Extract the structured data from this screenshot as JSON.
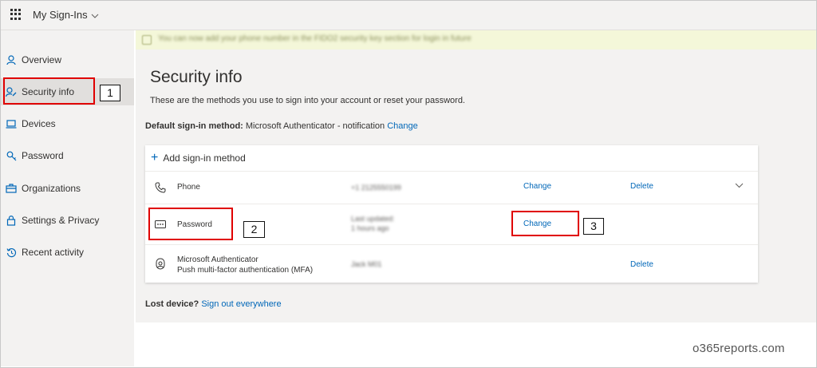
{
  "header": {
    "app_title": "My Sign-Ins",
    "title_chevron": "⌄"
  },
  "sidebar": {
    "items": [
      {
        "label": "Overview",
        "icon": "person-icon"
      },
      {
        "label": "Security info",
        "icon": "security-info-icon",
        "active": true
      },
      {
        "label": "Devices",
        "icon": "laptop-icon"
      },
      {
        "label": "Password",
        "icon": "key-icon"
      },
      {
        "label": "Organizations",
        "icon": "briefcase-icon"
      },
      {
        "label": "Settings & Privacy",
        "icon": "lock-icon"
      },
      {
        "label": "Recent activity",
        "icon": "history-icon"
      }
    ]
  },
  "banner": {
    "text": "You can now add your phone number in the FIDO2 security key section for login in future"
  },
  "main": {
    "title": "Security info",
    "description": "These are the methods you use to sign into your account or reset your password.",
    "default_label": "Default sign-in method:",
    "default_value": "Microsoft Authenticator - notification",
    "default_change": "Change",
    "add_method": "Add sign-in method",
    "methods": [
      {
        "name": "Phone",
        "detail": "+1 2125550199",
        "change": "Change",
        "delete": "Delete",
        "icon": "phone-icon"
      },
      {
        "name": "Password",
        "detail1": "Last updated:",
        "detail2": "1 hours ago",
        "change": "Change",
        "icon": "password-dots-icon"
      },
      {
        "name1": "Microsoft Authenticator",
        "name2": "Push multi-factor authentication (MFA)",
        "detail": "Jack M01",
        "delete": "Delete",
        "icon": "authenticator-icon"
      }
    ],
    "lost_label": "Lost device?",
    "lost_link": "Sign out everywhere"
  },
  "annotations": {
    "box1": "1",
    "box2": "2",
    "box3": "3"
  },
  "watermark": "o365reports.com",
  "colors": {
    "accent": "#0067b8",
    "highlight": "#e00000",
    "sidebar_bg": "#f3f2f1",
    "banner_bg": "#f4f7d9"
  }
}
